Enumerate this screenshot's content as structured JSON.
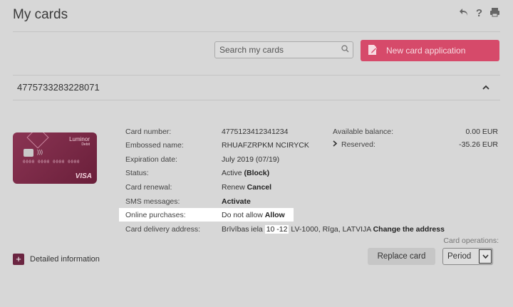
{
  "header": {
    "title": "My cards",
    "icons": [
      "back-icon",
      "help-icon",
      "print-icon"
    ]
  },
  "toolbar": {
    "search_placeholder": "Search my cards",
    "new_card_label": "New card application"
  },
  "account": {
    "number": "4775733283228071"
  },
  "card_image": {
    "brand": "Luminor",
    "sub": "Debit",
    "number": "0000 0000 0000 0000",
    "network": "VISA"
  },
  "details": {
    "card_number": {
      "label": "Card number:",
      "value": "4775123412341234"
    },
    "embossed": {
      "label": "Embossed name:",
      "value": "RHUAFZRPKM NCIRYCK"
    },
    "expiration": {
      "label": "Expiration date:",
      "value": "July 2019 (07/19)"
    },
    "status": {
      "label": "Status:",
      "value": "Active",
      "action": "(Block)"
    },
    "renewal": {
      "label": "Card renewal:",
      "value": "Renew",
      "action": "Cancel"
    },
    "sms": {
      "label": "SMS messages:",
      "action": "Activate"
    },
    "online": {
      "label": "Online purchases:",
      "value": "Do not allow",
      "action": "Allow"
    },
    "delivery": {
      "label": "Card delivery address:",
      "street": "Brīvības iela",
      "house": "10 -12",
      "rest": "LV-1000, Rīga, LATVIJA",
      "action": "Change the address"
    }
  },
  "balance": {
    "available_label": "Available balance:",
    "available_value": "0.00 EUR",
    "reserved_label": "Reserved:",
    "reserved_value": "-35.26 EUR"
  },
  "operations": {
    "label": "Card operations:",
    "replace_label": "Replace card",
    "period_value": "Period"
  },
  "detailed_info_label": "Detailed information",
  "colors": {
    "accent": "#d64a6a",
    "card": "#7a2a47",
    "background": "#d7d7d7"
  }
}
